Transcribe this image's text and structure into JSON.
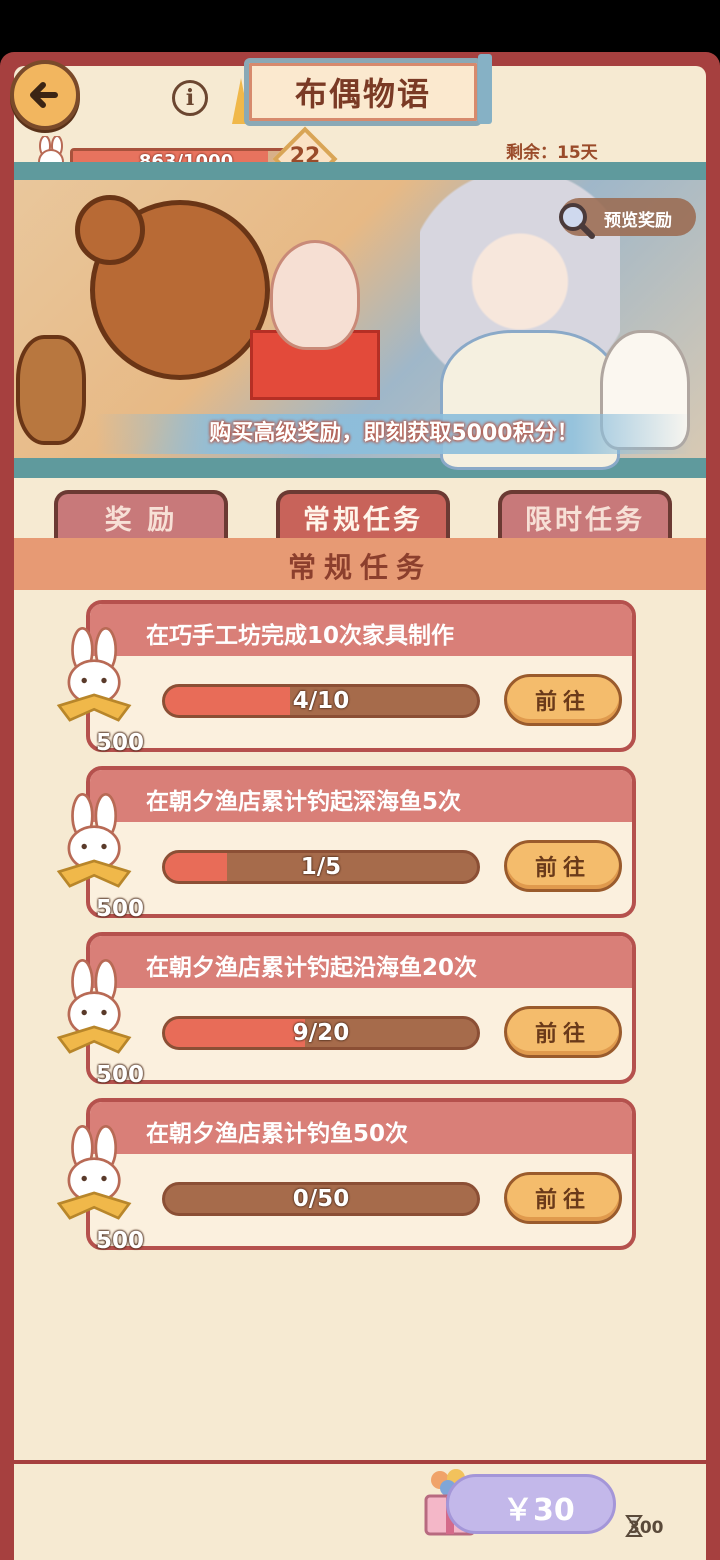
{
  "header": {
    "title": "布偶物语",
    "info_icon": "info-icon",
    "back_icon": "back-arrow-icon"
  },
  "progress": {
    "text": "863/1000",
    "current": 863,
    "max": 1000,
    "level": "22",
    "remaining": "剩余：15天"
  },
  "banner": {
    "preview_label": "预览奖励",
    "promo_text": "购买高级奖励，即刻获取5000积分！"
  },
  "tabs": [
    {
      "label": "奖 励",
      "active": false
    },
    {
      "label": "常规任务",
      "active": true
    },
    {
      "label": "限时任务",
      "active": false
    }
  ],
  "section": {
    "title": "常规任务"
  },
  "tasks": [
    {
      "title": "在巧手工坊完成10次家具制作",
      "progress": "4/10",
      "fraction": 0.4,
      "reward": "500",
      "button": "前往"
    },
    {
      "title": "在朝夕渔店累计钓起深海鱼5次",
      "progress": "1/5",
      "fraction": 0.2,
      "reward": "500",
      "button": "前往"
    },
    {
      "title": "在朝夕渔店累计钓起沿海鱼20次",
      "progress": "9/20",
      "fraction": 0.45,
      "reward": "500",
      "button": "前往"
    },
    {
      "title": "在朝夕渔店累计钓鱼50次",
      "progress": "0/50",
      "fraction": 0.0,
      "reward": "500",
      "button": "前往"
    }
  ],
  "purchase": {
    "price": "￥30",
    "gem_count": "300"
  },
  "colors": {
    "frame": "#a6403f",
    "background": "#f6ead2",
    "progress_fill": "#e86c58",
    "button": "#f4bc6c"
  }
}
